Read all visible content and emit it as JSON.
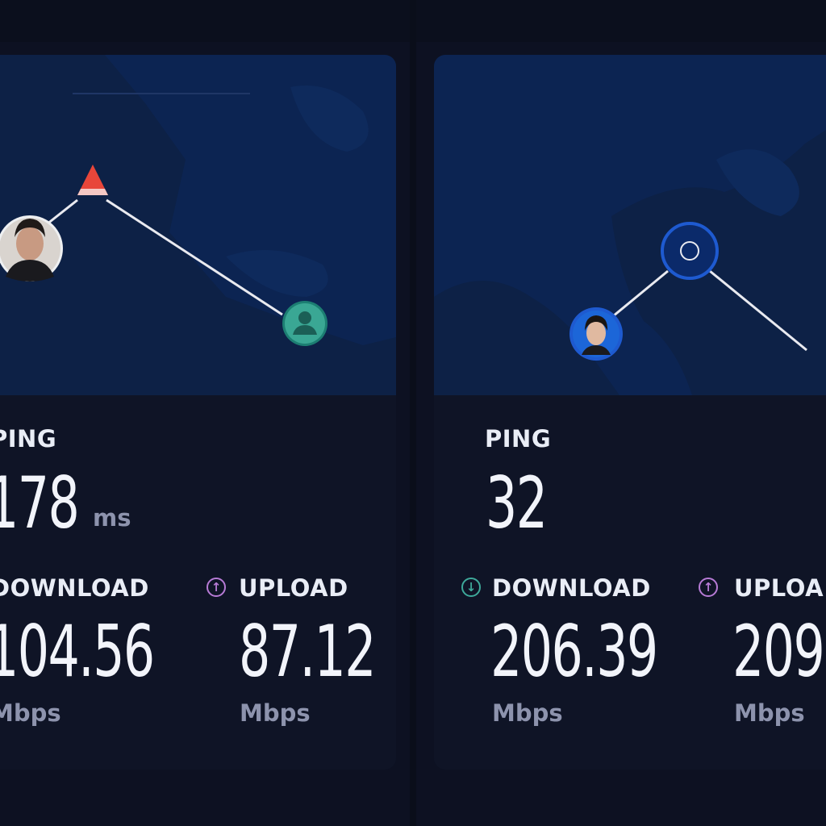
{
  "colors": {
    "page_bg": "#0d1122",
    "map_bg": "#0c2452",
    "download_accent": "#3ea99a",
    "upload_accent": "#b77bd6",
    "server_marker": "#e8463a",
    "route_line": "#e9eaf0"
  },
  "left_panel": {
    "ping_label": "PING",
    "ping_value": "178",
    "ping_unit": "ms",
    "download_label": "DOWNLOAD",
    "download_value": "104.56",
    "download_unit": "Mbps",
    "upload_label": "UPLOAD",
    "upload_value": "87.12",
    "upload_unit": "Mbps",
    "upload_icon": "arrow-up-circle-icon"
  },
  "right_panel": {
    "ping_label": "PING",
    "ping_value": "32",
    "download_label": "DOWNLOAD",
    "download_value": "206.39",
    "download_unit": "Mbps",
    "download_icon": "arrow-down-circle-icon",
    "upload_label": "UPLOA",
    "upload_value": "209.",
    "upload_unit": "Mbps",
    "upload_icon": "arrow-up-circle-icon"
  }
}
